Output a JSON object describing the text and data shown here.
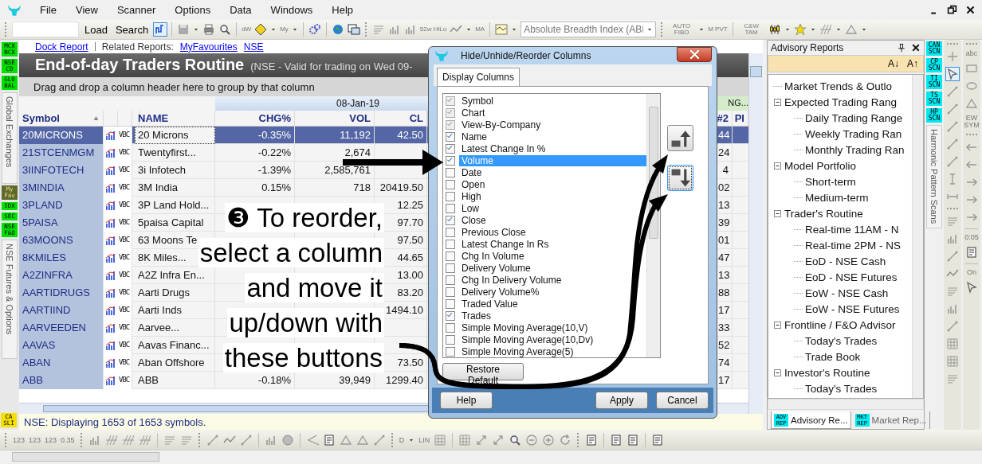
{
  "menu_bar": {
    "items": [
      "File",
      "View",
      "Scanner",
      "Options",
      "Data",
      "Windows",
      "Help"
    ]
  },
  "toolbar": {
    "buttons": [
      "Load",
      "Search"
    ],
    "labels": [
      "dW",
      "My",
      "52w HiLo",
      "MA",
      "AUTO FIBO",
      "M PVT",
      "C&W TAM"
    ],
    "indicator_dropdown": "Absolute Breadth Index (ABI"
  },
  "left_strip": {
    "groups": [
      {
        "badges": [
          {
            "label": "MCX NCX",
            "color": "#00e000"
          },
          {
            "label": "NSE CD",
            "color": "#00e000"
          },
          {
            "label": "GLO BAL",
            "color": "#00e000"
          }
        ],
        "title": "Global Exchanges"
      },
      {
        "badges": [
          {
            "label": "My Fav",
            "color": "#5f6a2a"
          },
          {
            "label": "IDX",
            "color": "#00e000"
          },
          {
            "label": "SEC",
            "color": "#00e000"
          },
          {
            "label": "NSE F&O",
            "color": "#00e000"
          }
        ],
        "title": "NSE Futures & Options"
      }
    ],
    "bottom_badge": {
      "label": "CA SLI",
      "color": "#f5e000"
    }
  },
  "report": {
    "dock_link": "Dock Report",
    "related_label": "Related Reports:",
    "related_links": [
      "MyFavourites",
      "NSE"
    ],
    "title": "End-of-day Traders Routine",
    "subtitle": "(NSE - Valid for trading on Wed 09-",
    "group_hint": "Drag and drop a column header here to group by that column"
  },
  "table": {
    "group_header": "08-Jan-19",
    "group_header_2": "NG...",
    "columns": [
      {
        "label": "Symbol",
        "sort_ascending": true
      },
      {
        "label": "NAME"
      },
      {
        "label": "CHG%"
      },
      {
        "label": "VOL"
      },
      {
        "label": "CL"
      },
      {
        "label": "#2"
      },
      {
        "label": "PI"
      }
    ],
    "rows": [
      {
        "symbol": "20MICRONS",
        "vbc": "VBC",
        "name": "20 Microns",
        "chg_pct": "-0.35%",
        "vol": "11,192",
        "cl": "42.50",
        "number_2": "44",
        "selected": true
      },
      {
        "symbol": "21STCENMGM",
        "vbc": "VBC",
        "name": "Twentyfirst...",
        "chg_pct": "-0.22%",
        "vol": "2,674",
        "number_2": "24",
        "selected": false
      },
      {
        "symbol": "3IINFOTECH",
        "vbc": "VBC",
        "name": "3i Infotech",
        "chg_pct": "-1.39%",
        "vol": "2,585,761",
        "number_2": "4",
        "selected": false
      },
      {
        "symbol": "3MINDIA",
        "vbc": "VBC",
        "name": "3M India",
        "chg_pct": "0.15%",
        "vol": "718",
        "cl": "20419.50",
        "number_2": "02",
        "selected": false
      },
      {
        "symbol": "3PLAND",
        "vbc": "VBC",
        "name": "3P Land Hold...",
        "cl": "12.25",
        "number_2": "13",
        "selected": false
      },
      {
        "symbol": "5PAISA",
        "vbc": "VBC",
        "name": "5paisa Capital",
        "cl": "97.70",
        "number_2": "39",
        "selected": false
      },
      {
        "symbol": "63MOONS",
        "vbc": "VBC",
        "name": "63 Moons Te",
        "cl": "97.50",
        "number_2": "01",
        "selected": false
      },
      {
        "symbol": "8KMILES",
        "vbc": "VBC",
        "name": "8K Miles...",
        "cl": "44.65",
        "number_2": "47",
        "selected": false
      },
      {
        "symbol": "A2ZINFRA",
        "vbc": "VBC",
        "name": "A2Z Infra En...",
        "cl": "13.00",
        "number_2": "13",
        "selected": false
      },
      {
        "symbol": "AARTIDRUGS",
        "vbc": "VBC",
        "name": "Aarti Drugs",
        "cl": "83.20",
        "number_2": "88",
        "selected": false
      },
      {
        "symbol": "AARTIIND",
        "vbc": "VBC",
        "name": "Aarti Inds",
        "cl": "1494.10",
        "number_2": "17",
        "selected": false
      },
      {
        "symbol": "AARVEEDEN",
        "vbc": "VBC",
        "name": "Aarvee...",
        "number_2": "33",
        "selected": false
      },
      {
        "symbol": "AAVAS",
        "vbc": "VBC",
        "name": "Aavas Financ...",
        "number_2": "52",
        "selected": false
      },
      {
        "symbol": "ABAN",
        "vbc": "VBC",
        "name": "Aban Offshore",
        "cl": "73.50",
        "number_2": "74",
        "selected": false
      },
      {
        "symbol": "ABB",
        "vbc": "VBC",
        "name": "ABB",
        "chg_pct": "-0.18%",
        "vol": "39,949",
        "cl": "1299.40",
        "number_2": "17",
        "selected": false
      }
    ]
  },
  "status_bar": "NSE: Displaying 1653 of 1653 symbols.",
  "dialog": {
    "title": "Hide/Unhide/Reorder Columns",
    "tabs": [
      {
        "label": "Display Columns",
        "selected": true
      }
    ],
    "columns": [
      {
        "label": "Symbol",
        "checked": true,
        "disabled": true,
        "selected": false
      },
      {
        "label": "Chart",
        "checked": true,
        "disabled": true,
        "selected": false
      },
      {
        "label": "View-By-Company",
        "checked": true,
        "disabled": true,
        "selected": false
      },
      {
        "label": "Name",
        "checked": true,
        "disabled": false,
        "selected": false
      },
      {
        "label": "Latest Change In %",
        "checked": true,
        "disabled": false,
        "selected": false
      },
      {
        "label": "Volume",
        "checked": true,
        "disabled": false,
        "selected": true
      },
      {
        "label": "Date",
        "checked": false,
        "disabled": false,
        "selected": false
      },
      {
        "label": "Open",
        "checked": false,
        "disabled": false,
        "selected": false
      },
      {
        "label": "High",
        "checked": false,
        "disabled": false,
        "selected": false
      },
      {
        "label": "Low",
        "checked": false,
        "disabled": false,
        "selected": false
      },
      {
        "label": "Close",
        "checked": true,
        "disabled": false,
        "selected": false
      },
      {
        "label": "Previous Close",
        "checked": false,
        "disabled": false,
        "selected": false
      },
      {
        "label": "Latest Change In Rs",
        "checked": false,
        "disabled": false,
        "selected": false
      },
      {
        "label": "Chg In Volume",
        "checked": false,
        "disabled": false,
        "selected": false
      },
      {
        "label": "Delivery Volume",
        "checked": false,
        "disabled": false,
        "selected": false
      },
      {
        "label": "Chg In Delivery Volume",
        "checked": false,
        "disabled": false,
        "selected": false
      },
      {
        "label": "Delivery Volume%",
        "checked": false,
        "disabled": false,
        "selected": false
      },
      {
        "label": "Traded Value",
        "checked": false,
        "disabled": false,
        "selected": false
      },
      {
        "label": "Trades",
        "checked": true,
        "disabled": false,
        "selected": false
      },
      {
        "label": "Simple Moving Average(10,V)",
        "checked": false,
        "disabled": false,
        "selected": false
      },
      {
        "label": "Simple Moving Average(10,Dv)",
        "checked": false,
        "disabled": false,
        "selected": false
      },
      {
        "label": "Simple Moving Average(5)",
        "checked": false,
        "disabled": false,
        "selected": false
      }
    ],
    "restore_button": "Restore Default",
    "buttons": [
      "Help",
      "Apply",
      "Cancel"
    ]
  },
  "annotation": {
    "step": "❸",
    "lines": [
      "To reorder,",
      "select a column",
      "and move it",
      "up/down with",
      "these buttons"
    ]
  },
  "advisory_panel": {
    "title": "Advisory Reports",
    "sort_buttons": [
      "A↓",
      "A↑"
    ],
    "tree": [
      {
        "label": "Market Trends & Outlo"
      },
      {
        "label": "Expected Trading Rang",
        "expanded": true,
        "children": [
          {
            "label": "Daily Trading Range"
          },
          {
            "label": "Weekly Trading Ran"
          },
          {
            "label": "Monthly Trading Ran"
          }
        ]
      },
      {
        "label": "Model Portfolio",
        "expanded": true,
        "children": [
          {
            "label": "Short-term"
          },
          {
            "label": "Medium-term"
          }
        ]
      },
      {
        "label": "Trader's Routine",
        "expanded": true,
        "children": [
          {
            "label": "Real-time 11AM - N"
          },
          {
            "label": "Real-time 2PM - NS"
          },
          {
            "label": "EoD - NSE Cash"
          },
          {
            "label": "EoD - NSE Futures"
          },
          {
            "label": "EoW - NSE Cash"
          },
          {
            "label": "EoW - NSE Futures"
          }
        ]
      },
      {
        "label": "Frontline / F&O Advisor",
        "expanded": true,
        "children": [
          {
            "label": "Today's Trades"
          },
          {
            "label": "Trade Book"
          }
        ]
      },
      {
        "label": "Investor's Routine",
        "expanded": true,
        "children": [
          {
            "label": "Today's Trades"
          }
        ]
      }
    ],
    "tabs": [
      {
        "badge": "ADV REP",
        "label": "Advisory Re...",
        "selected": true
      },
      {
        "badge": "MKT REP",
        "label": "Market Rep...",
        "selected": false
      }
    ]
  },
  "scan_strip": {
    "badges": [
      {
        "label": "CAN SCN",
        "color": "#00e8f0"
      },
      {
        "label": "CP SCN",
        "color": "#00e8f0"
      },
      {
        "label": "TI SCN",
        "color": "#00e8f0"
      },
      {
        "label": "TS SCN",
        "color": "#00e8f0"
      },
      {
        "label": "HP SCN",
        "color": "#00e8f0"
      }
    ],
    "title": "Harmonic Pattern Scans"
  },
  "drawing_tools": {
    "labels": [
      "abc",
      "EW SYM",
      "0:05",
      "On"
    ]
  },
  "bottom_toolbar": {
    "labels": [
      "123",
      "123",
      "123",
      "0.35",
      "D",
      "LIN"
    ]
  }
}
